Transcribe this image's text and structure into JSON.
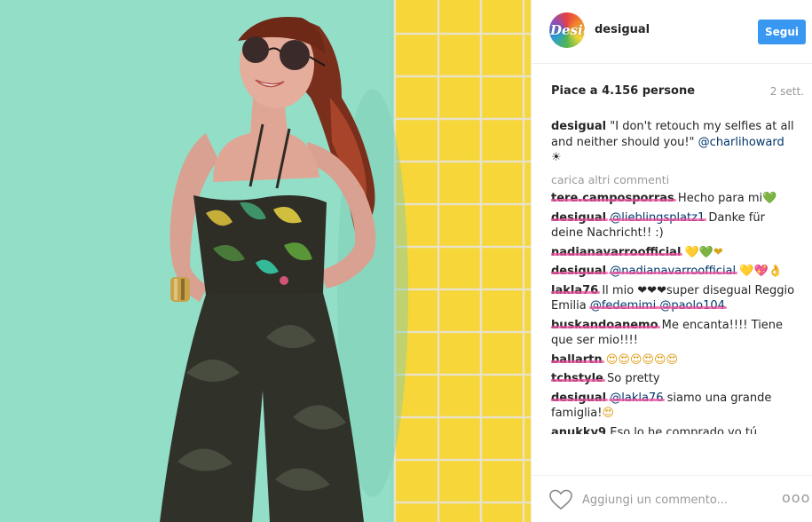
{
  "post": {
    "username": "desigual",
    "avatar_text": "Desig",
    "follow_label": "Segui",
    "likes": "Piace a 4.156 persone",
    "time": "2 sett.",
    "caption_text": "\"I don't retouch my selfies at all and neither should you!\"",
    "caption_mention": "@charlihoward",
    "caption_emoji": "☀"
  },
  "comments": {
    "load_more": "carica altri commenti",
    "items": [
      {
        "user": "tere.camposporras",
        "text": "Hecho para mi",
        "emoji": "💚"
      },
      {
        "user": "desigual",
        "mention": "@lieblingsplatz1",
        "text": "Danke für deine Nachricht!! :)"
      },
      {
        "user": "nadianavarroofficial",
        "text": "",
        "emoji": "💛💚❤"
      },
      {
        "user": "desigual",
        "mention": "@nadianavarroofficial",
        "text": "",
        "emoji": "💛💖👌"
      },
      {
        "user": "lakla76",
        "text": "Il mio ❤❤❤super disegual Reggio Emilia",
        "mention_after": "@fedemimi @paolo104"
      },
      {
        "user": "buskandoanemo",
        "text": "Me encanta!!!! Tiene que ser mio!!!!"
      },
      {
        "user": "ballartn",
        "text": "",
        "emoji": "😍😍😍😍😍😍"
      },
      {
        "user": "tchstyle",
        "text": "So pretty"
      },
      {
        "user": "desigual",
        "mention": "@lakla76",
        "text": "siamo una grande famiglia!",
        "emoji": "😍"
      },
      {
        "user": "anukky9",
        "text": "Eso lo he comprado yo tú"
      }
    ]
  },
  "footer": {
    "comment_placeholder": "Aggiungi un commento...",
    "more_dots": "ooo",
    "heart_icon": "heart-outline-icon"
  },
  "colors": {
    "follow": "#3897f0",
    "wall": "#8fdcc4",
    "tiles": "#f5d33a"
  }
}
